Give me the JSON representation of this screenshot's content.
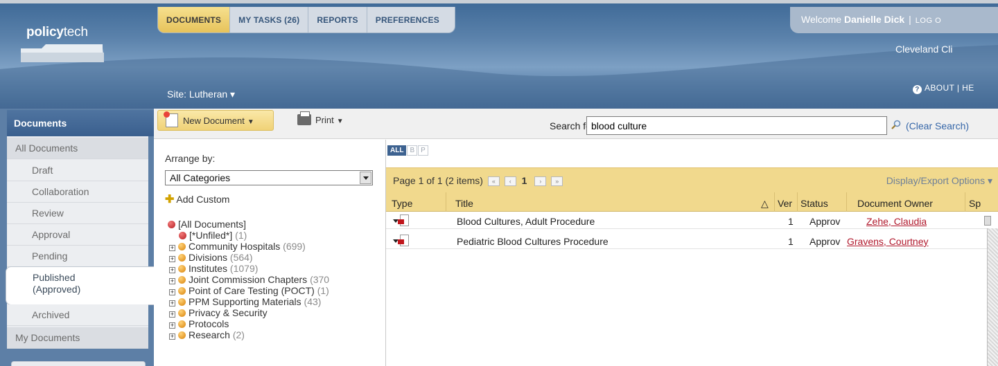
{
  "app": {
    "logo_bold": "policy",
    "logo_light": "tech"
  },
  "main_tabs": [
    {
      "label": "DOCUMENTS",
      "active": true
    },
    {
      "label": "MY TASKS (26)"
    },
    {
      "label": "REPORTS"
    },
    {
      "label": "PREFERENCES"
    }
  ],
  "user": {
    "welcome_prefix": "Welcome",
    "name": "Danielle Dick",
    "separator": "|",
    "logout": "LOG O",
    "org": "Cleveland Cli",
    "about": "ABOUT",
    "help": "HE"
  },
  "site": {
    "label": "Site: Lutheran ▾"
  },
  "leftnav": {
    "header": "Documents",
    "items": [
      {
        "label": "All Documents"
      },
      {
        "label": "Draft"
      },
      {
        "label": "Collaboration"
      },
      {
        "label": "Review"
      },
      {
        "label": "Approval"
      },
      {
        "label": "Pending"
      },
      {
        "label_line1": "Published",
        "label_line2": "(Approved)",
        "selected": true
      },
      {
        "label": "Archived"
      },
      {
        "label": "My Documents"
      }
    ]
  },
  "toolbar": {
    "new_document": "New Document",
    "print": "Print",
    "search_label": "Search for",
    "search_value": "blood culture",
    "clear_search": "(Clear Search)"
  },
  "arrange": {
    "label": "Arrange by:",
    "selected": "All Categories",
    "add_custom": "Add Custom",
    "tree": [
      {
        "label": "[All Documents]",
        "count": ""
      },
      {
        "label": "[*Unfiled*]",
        "count": "(1)"
      },
      {
        "label": "Community Hospitals",
        "count": "(699)"
      },
      {
        "label": "Divisions",
        "count": "(564)"
      },
      {
        "label": "Institutes",
        "count": "(1079)"
      },
      {
        "label": "Joint Commission Chapters",
        "count": "(370"
      },
      {
        "label": "Point of Care Testing (POCT)",
        "count": "(1)"
      },
      {
        "label": "PPM Supporting Materials",
        "count": "(43)"
      },
      {
        "label": "Privacy & Security",
        "count": ""
      },
      {
        "label": "Protocols",
        "count": ""
      },
      {
        "label": "Research",
        "count": "(2)"
      }
    ]
  },
  "results": {
    "letters": [
      "ALL",
      "B",
      "P"
    ],
    "page_text": "Page 1 of 1 (2 items)",
    "current_page": "1",
    "pager_first": "«",
    "pager_prev": "‹",
    "pager_next": "›",
    "pager_last": "»",
    "display_export": "Display/Export Options ▾",
    "columns": {
      "type": "Type",
      "title": "Title",
      "sort_glyph": "△",
      "ver": "Ver",
      "status": "Status",
      "owner": "Document Owner",
      "extra": "Sp"
    },
    "rows": [
      {
        "title": "Blood Cultures, Adult Procedure",
        "ver": "1",
        "status": "Approv",
        "owner": "Zehe, Claudia"
      },
      {
        "title": "Pediatric Blood Cultures Procedure",
        "ver": "1",
        "status": "Approv",
        "owner": "Gravens, Courtney"
      }
    ]
  },
  "colors": {
    "header_blue": "#5b82ab",
    "tab_active_gold": "#e6c25a",
    "results_bar_gold": "#f1d98d",
    "link_blue": "#3566a8",
    "owner_red": "#b0172b"
  }
}
